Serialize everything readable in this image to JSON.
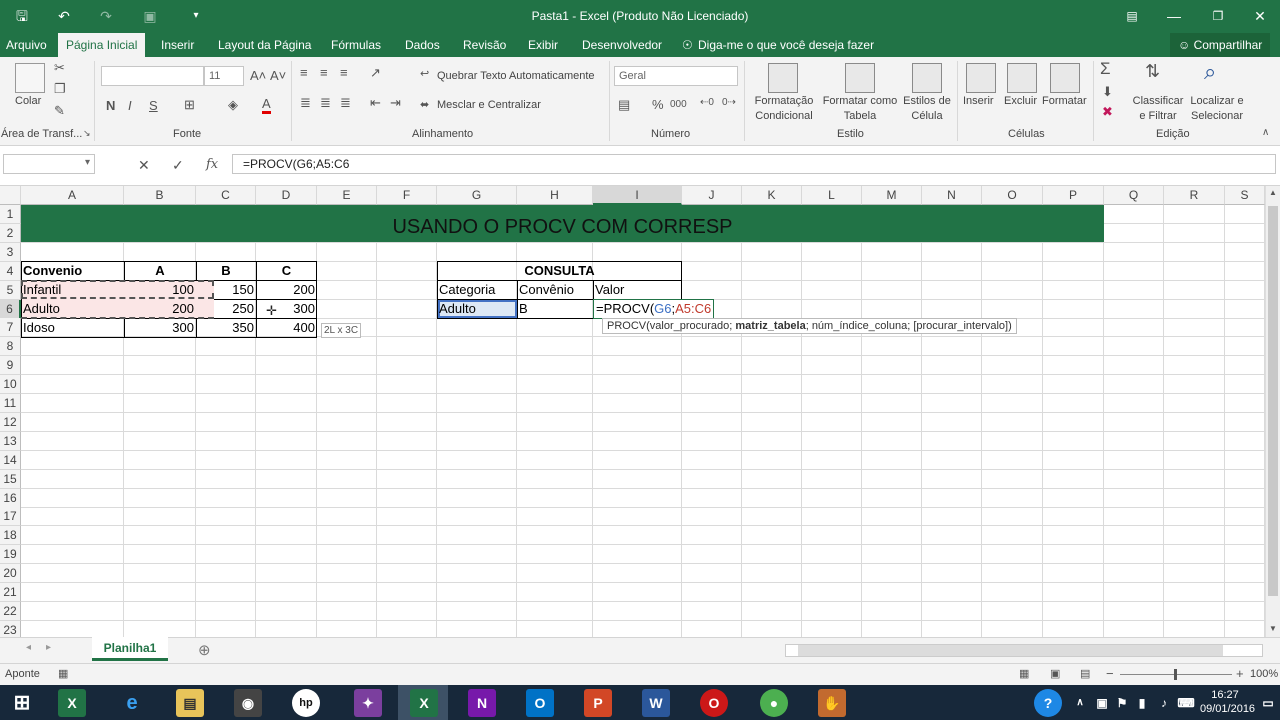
{
  "window": {
    "title": "Pasta1 - Excel (Produto Não Licenciado)"
  },
  "tabs": [
    "Arquivo",
    "Página Inicial",
    "Inserir",
    "Layout da Página",
    "Fórmulas",
    "Dados",
    "Revisão",
    "Exibir",
    "Desenvolvedor"
  ],
  "tell_me": "Diga-me o que você deseja fazer",
  "share": "Compartilhar",
  "ribbon": {
    "paste": "Colar",
    "clipboard": "Área de Transf...",
    "font_group": "Fonte",
    "font_size": "11",
    "bold": "N",
    "italic": "I",
    "underline": "S",
    "alignment": "Alinhamento",
    "wrap": "Quebrar Texto Automaticamente",
    "merge": "Mesclar e Centralizar",
    "number_format": "Geral",
    "number": "Número",
    "percent": "%",
    "comma": "000",
    "cond_format": "Formatação",
    "cond_format2": "Condicional",
    "format_table": "Formatar como",
    "format_table2": "Tabela",
    "cell_styles": "Estilos de",
    "cell_styles2": "Célula",
    "styles": "Estilo",
    "insert": "Inserir",
    "delete": "Excluir",
    "format": "Formatar",
    "cells": "Células",
    "sort": "Classificar",
    "sort2": "e Filtrar",
    "find": "Localizar e",
    "find2": "Selecionar",
    "editing": "Edição"
  },
  "formula_bar": {
    "content": "=PROCV(G6;A5:C6"
  },
  "columns": [
    "A",
    "B",
    "C",
    "D",
    "E",
    "F",
    "G",
    "H",
    "I",
    "J",
    "K",
    "L",
    "M",
    "N",
    "O",
    "P",
    "Q",
    "R",
    "S"
  ],
  "rows": [
    "1",
    "2",
    "3",
    "4",
    "5",
    "6",
    "7",
    "8",
    "9",
    "10",
    "11",
    "12",
    "13",
    "14",
    "15",
    "16",
    "17",
    "18",
    "19",
    "20",
    "21",
    "22",
    "23"
  ],
  "banner": "USANDO O PROCV COM CORRESP",
  "table": {
    "headers": [
      "Convenio",
      "A",
      "B",
      "C"
    ],
    "rows": [
      [
        "Infantil",
        "100",
        "150",
        "200"
      ],
      [
        "Adulto",
        "200",
        "250",
        "300"
      ],
      [
        "Idoso",
        "300",
        "350",
        "400"
      ]
    ]
  },
  "consulta": {
    "title": "CONSULTA",
    "headers": [
      "Categoria",
      "Convênio",
      "Valor"
    ],
    "values": [
      "Adulto",
      "B"
    ],
    "formula_prefix": "=PROCV(",
    "formula_arg1": "G6",
    "formula_sep": ";",
    "formula_arg2": "A5:C6"
  },
  "size_tip": "2L x 3C",
  "tooltip": {
    "fn": "PROCV(valor_procurado; ",
    "bold": "matriz_tabela",
    "rest": "; núm_índice_coluna; [procurar_intervalo])"
  },
  "sheet_tab": "Planilha1",
  "status": "Aponte",
  "zoom": "100%",
  "clock": {
    "time": "16:27",
    "date": "09/01/2016"
  }
}
